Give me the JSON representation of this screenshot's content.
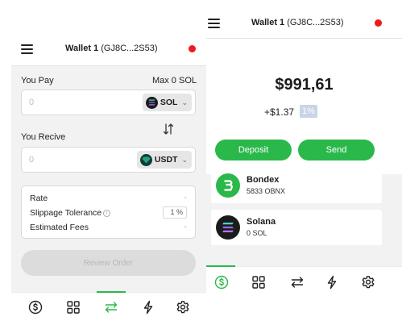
{
  "left": {
    "header": {
      "wallet_name": "Wallet 1",
      "wallet_address": "(GJ8C...2S53)"
    },
    "you_pay": {
      "label": "You Pay",
      "max_label": "Max 0 SOL",
      "amount_placeholder": "0",
      "token": "SOL"
    },
    "you_receive": {
      "label": "You Recive",
      "amount_placeholder": "0",
      "token": "USDT"
    },
    "info": {
      "rate_label": "Rate",
      "rate_value": "-",
      "slippage_label": "Slippage Tolerance",
      "slippage_value": "1 %",
      "fees_label": "Estimated Fees",
      "fees_value": "-"
    },
    "review_button": "Review Order",
    "nav": [
      "dollar-icon",
      "grid-icon",
      "swap-icon",
      "lightning-icon",
      "gear-icon"
    ],
    "nav_active": "swap-icon"
  },
  "right": {
    "header": {
      "wallet_name": "Wallet 1",
      "wallet_address": "(GJ8C...2S53)"
    },
    "balance": "$991,61",
    "change": "+$1.37",
    "change_pct": "1%",
    "deposit_label": "Deposit",
    "send_label": "Send",
    "assets": [
      {
        "name": "Bondex",
        "amount": "5833 OBNX",
        "icon": "bondex-icon"
      },
      {
        "name": "Solana",
        "amount": "0 SOL",
        "icon": "solana-icon"
      }
    ],
    "nav": [
      "dollar-icon",
      "grid-icon",
      "swap-icon",
      "lightning-icon",
      "gear-icon"
    ],
    "nav_active": "dollar-icon"
  },
  "colors": {
    "accent_green": "#2bb84b",
    "status_red": "#ef1a1a",
    "badge_blue": "#c9d4e6"
  }
}
